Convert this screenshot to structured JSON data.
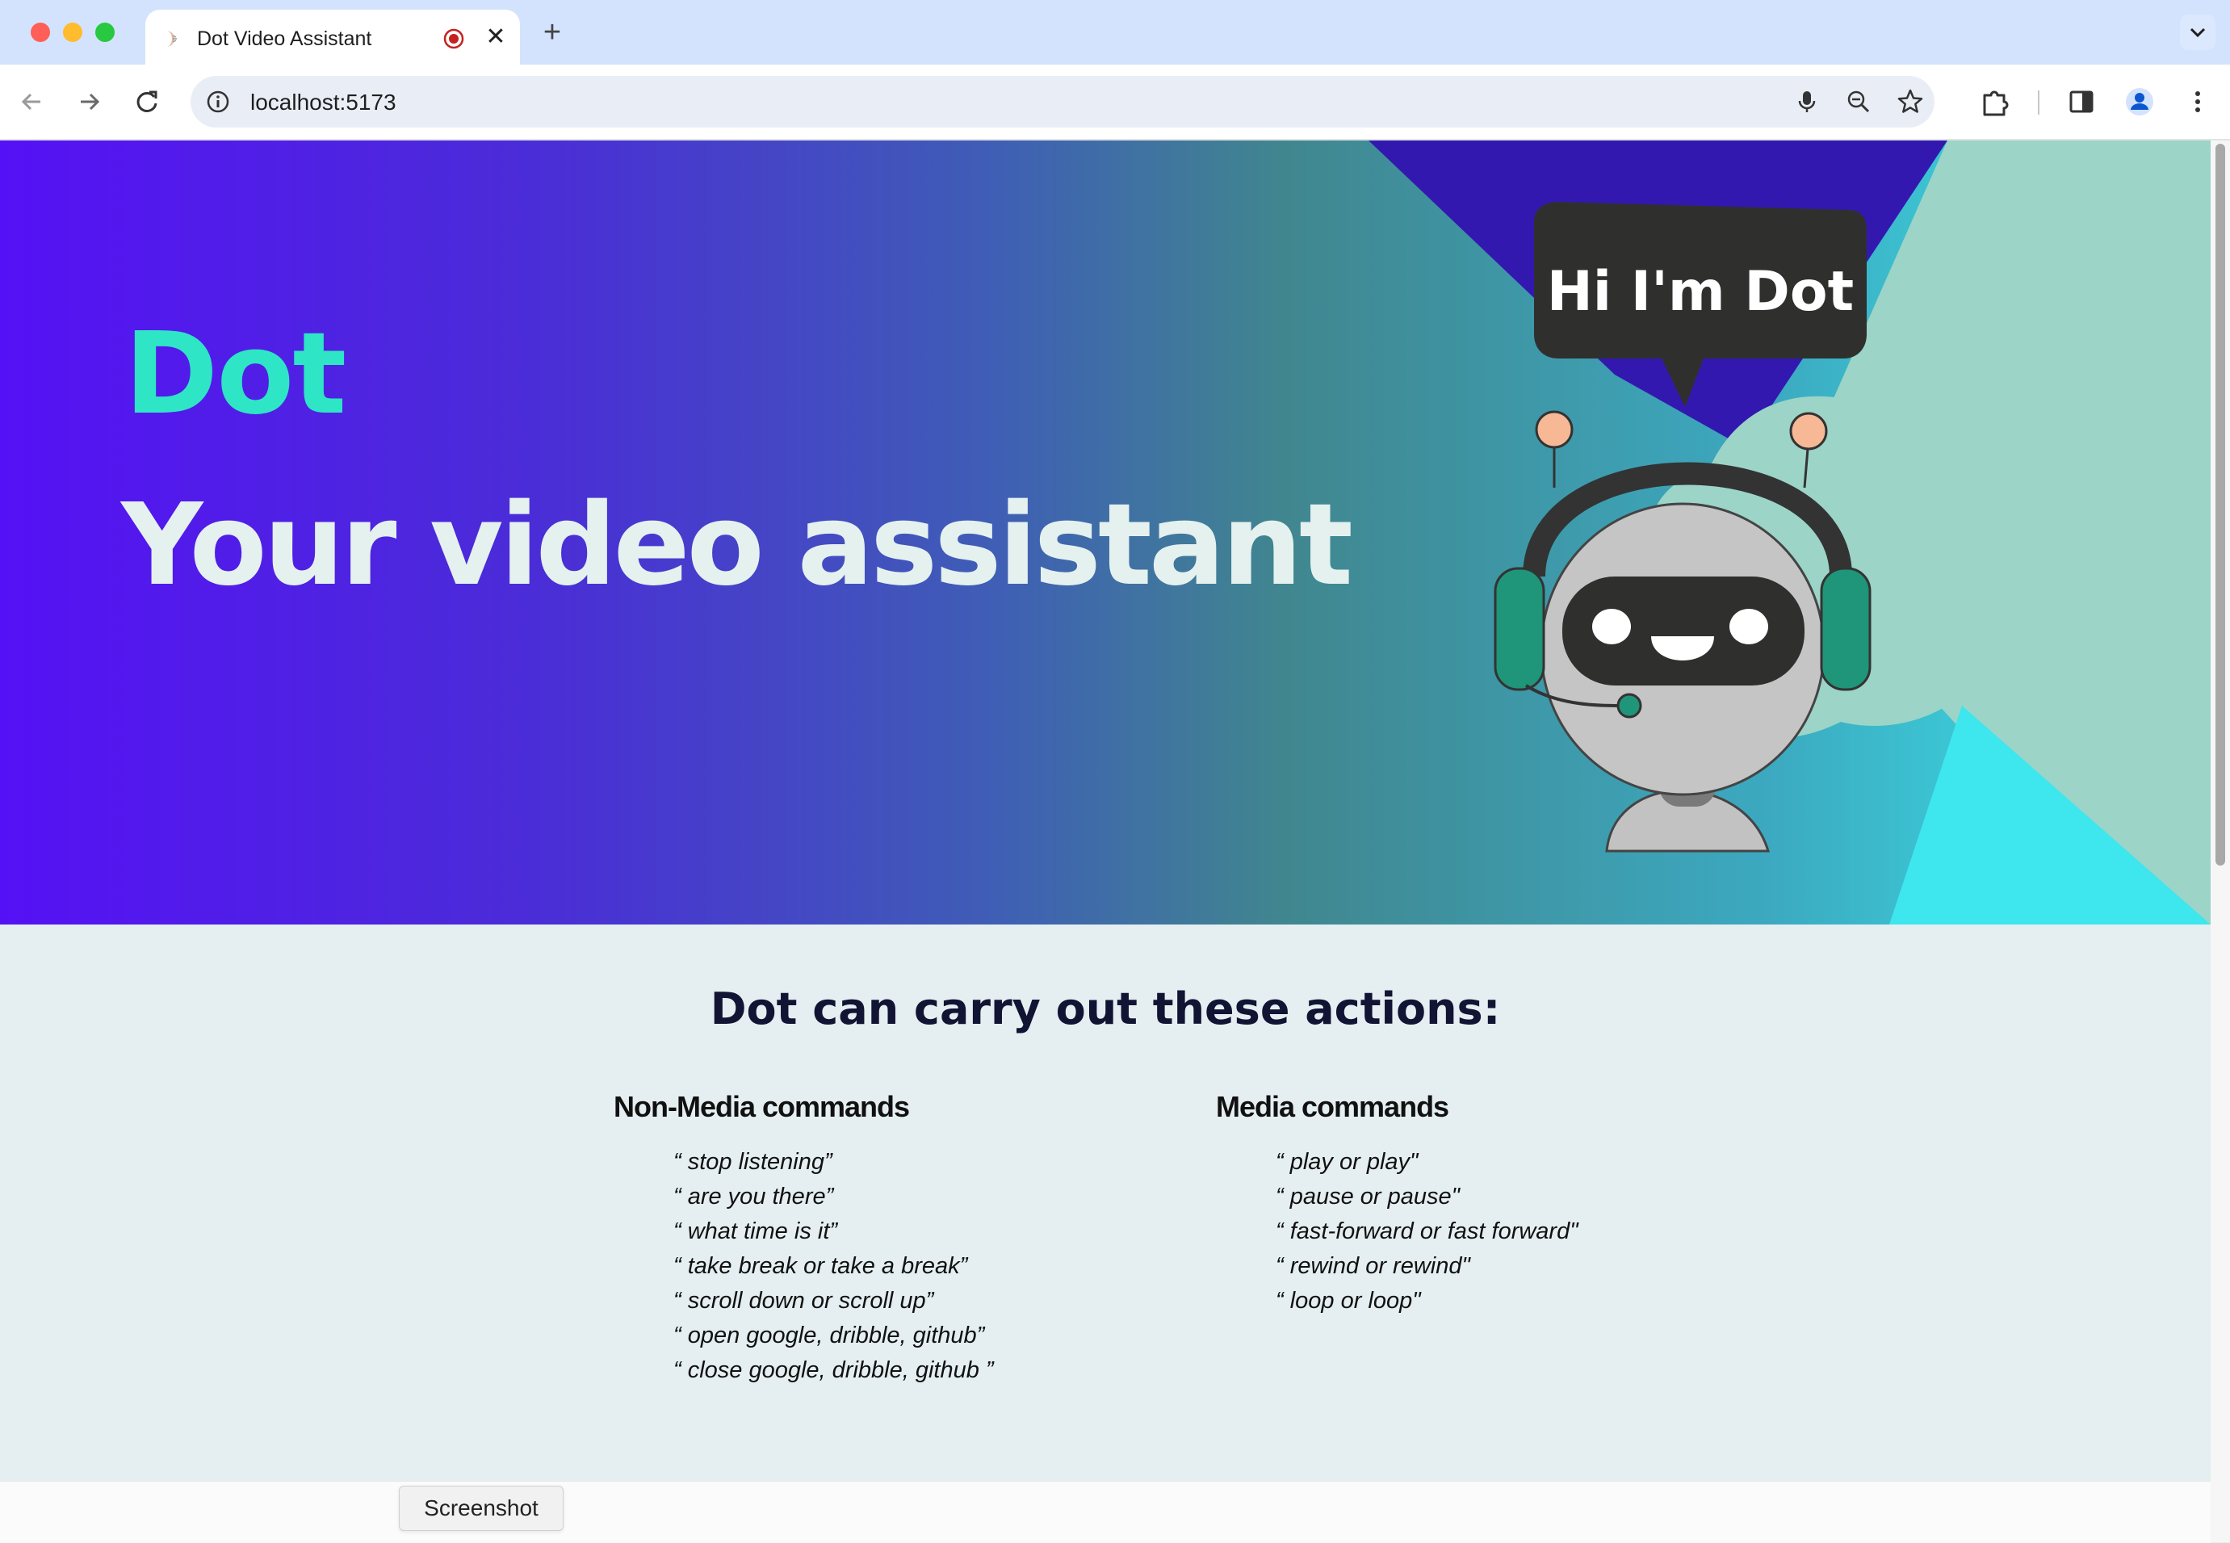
{
  "browser": {
    "tab_title": "Dot Video Assistant",
    "url": "localhost:5173",
    "new_tab_label": "+",
    "close_tab_label": "✕"
  },
  "hero": {
    "title": "Dot",
    "subtitle": "Your video assistant",
    "speech_bubble": "Hi I'm Dot",
    "colors": {
      "title": "#2ee5c6",
      "subtitle": "#e4f1ef",
      "gradient_start": "#5511f5",
      "gradient_end": "#3aecef"
    }
  },
  "actions": {
    "heading": "Dot can carry out these actions:",
    "non_media": {
      "title": "Non-Media commands",
      "items": [
        "“ stop listening”",
        "“ are you there”",
        "“ what time is it”",
        "“ take break or take a break”",
        "“ scroll down or scroll up”",
        "“ open google, dribble, github”",
        "“ close google, dribble, github ”"
      ]
    },
    "media": {
      "title": "Media commands",
      "items": [
        "“ play or play\"",
        "“ pause or pause\"",
        "“ fast-forward or fast forward\"",
        "“ rewind or rewind\"",
        "“ loop or loop\""
      ]
    }
  },
  "tooltip": {
    "text": "Screenshot"
  },
  "icons": [
    "back-icon",
    "forward-icon",
    "reload-icon",
    "info-icon",
    "mic-icon",
    "zoom-out-icon",
    "star-icon",
    "extensions-icon",
    "side-panel-icon",
    "profile-icon",
    "more-icon",
    "record-icon",
    "tab-favicon",
    "chevron-down-icon"
  ]
}
